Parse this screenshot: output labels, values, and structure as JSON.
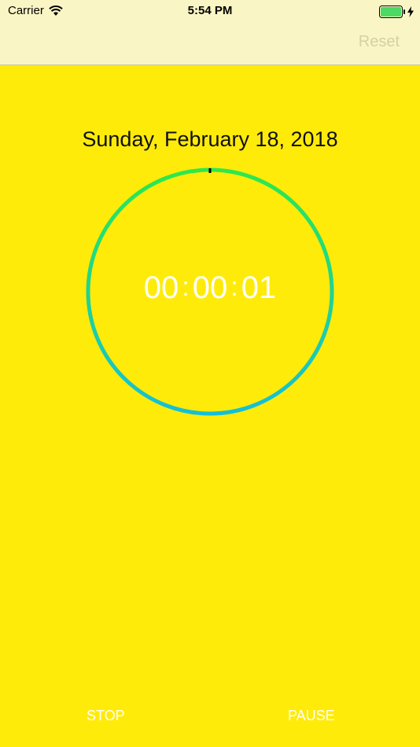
{
  "status_bar": {
    "carrier": "Carrier",
    "time": "5:54 PM"
  },
  "nav": {
    "reset_label": "Reset"
  },
  "main": {
    "date": "Sunday, February 18, 2018",
    "timer": {
      "hours": "00",
      "minutes": "00",
      "seconds": "01",
      "separator": ":"
    }
  },
  "controls": {
    "stop_label": "STOP",
    "pause_label": "PAUSE"
  },
  "colors": {
    "background": "#FFEB0A",
    "bar": "#FAF5C4",
    "ring_top": "#2EE84A",
    "ring_bottom": "#14BFD8",
    "battery": "#4CD964"
  },
  "icons": {
    "wifi": "wifi-icon",
    "battery": "battery-icon",
    "charging": "charging-bolt-icon"
  }
}
